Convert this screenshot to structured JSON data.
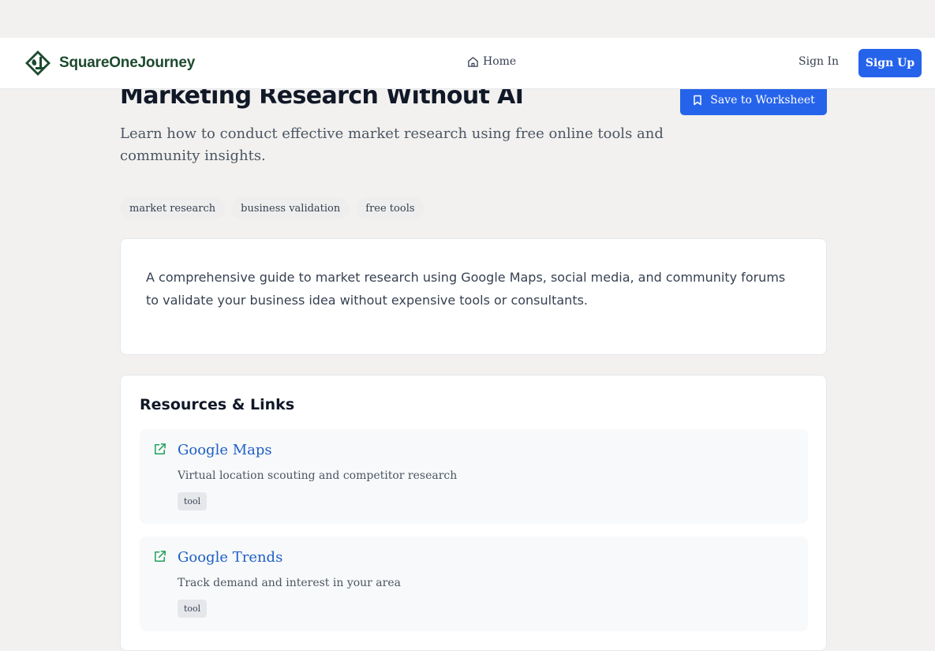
{
  "header": {
    "brand": "SquareOneJourney",
    "nav_home": "Home",
    "sign_in": "Sign In",
    "sign_up": "Sign Up"
  },
  "page": {
    "title": "Marketing Research Without AI",
    "subtitle": "Learn how to conduct effective market research using free online tools and community insights.",
    "save_button": "Save to Worksheet",
    "tags": [
      "market research",
      "business validation",
      "free tools"
    ],
    "description": "A comprehensive guide to market research using Google Maps, social media, and community forums to validate your business idea without expensive tools or consultants."
  },
  "resources": {
    "title": "Resources & Links",
    "items": [
      {
        "name": "Google Maps",
        "description": "Virtual location scouting and competitor research",
        "type": "tool"
      },
      {
        "name": "Google Trends",
        "description": "Track demand and interest in your area",
        "type": "tool"
      }
    ]
  },
  "colors": {
    "accent": "#2563eb",
    "brand": "#1d4a2e",
    "link": "#1d5fc4",
    "external_icon": "#22a35a",
    "background": "#f2f1ef"
  },
  "icons": {
    "brand": "square-one-logo-icon",
    "home": "home-icon",
    "save": "bookmark-icon",
    "resource": "external-link-icon"
  }
}
